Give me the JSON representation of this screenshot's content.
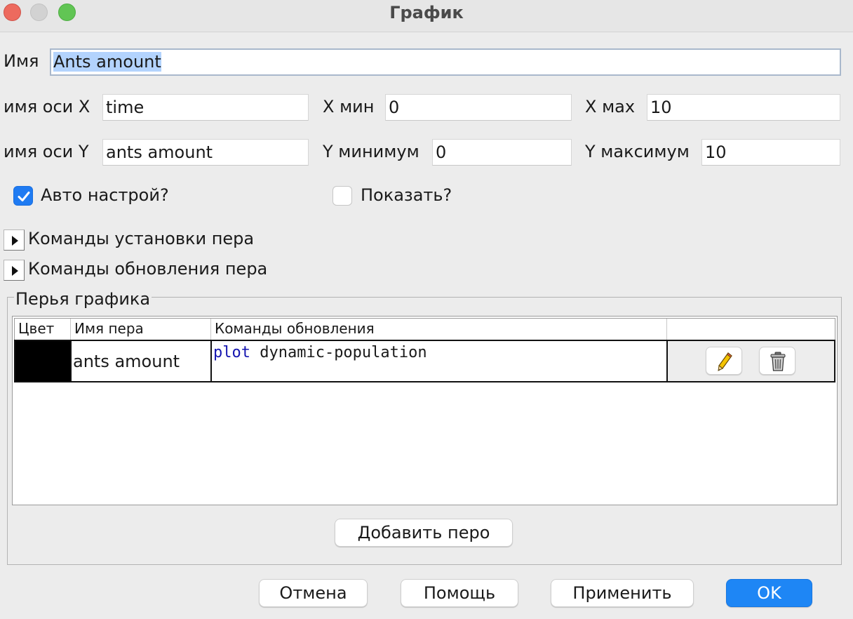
{
  "window": {
    "title": "График"
  },
  "form": {
    "name_label": "Имя",
    "name_value": "Ants amount",
    "x_axis_label": "имя оси X",
    "x_axis_value": "time",
    "x_min_label": "X мин",
    "x_min_value": "0",
    "x_max_label": "X мах",
    "x_max_value": "10",
    "y_axis_label": "имя оси Y",
    "y_axis_value": "ants amount",
    "y_min_label": "Y минимум",
    "y_min_value": "0",
    "y_max_label": "Y максимум",
    "y_max_value": "10",
    "autoscale_label": "Авто настрой?",
    "autoscale_checked": true,
    "show_legend_label": "Показать?",
    "show_legend_checked": false
  },
  "sections": {
    "setup_commands_label": "Команды установки пера",
    "update_commands_label": "Команды обновления пера"
  },
  "pens": {
    "group_title": "Перья графика",
    "columns": [
      "Цвет",
      "Имя пера",
      "Команды обновления",
      ""
    ],
    "rows": [
      {
        "color": "#000000",
        "name": "ants amount",
        "command_keyword": "plot",
        "command_rest": " dynamic-population"
      }
    ],
    "edit_icon": "pencil-icon",
    "delete_icon": "trash-icon",
    "add_pen_label": "Добавить перо"
  },
  "footer": {
    "cancel_label": "Отмена",
    "help_label": "Помощь",
    "apply_label": "Применить",
    "ok_label": "OK"
  },
  "colors": {
    "accent": "#1e86f5",
    "selection": "#b3d3fd",
    "keyword": "#1515b0"
  }
}
